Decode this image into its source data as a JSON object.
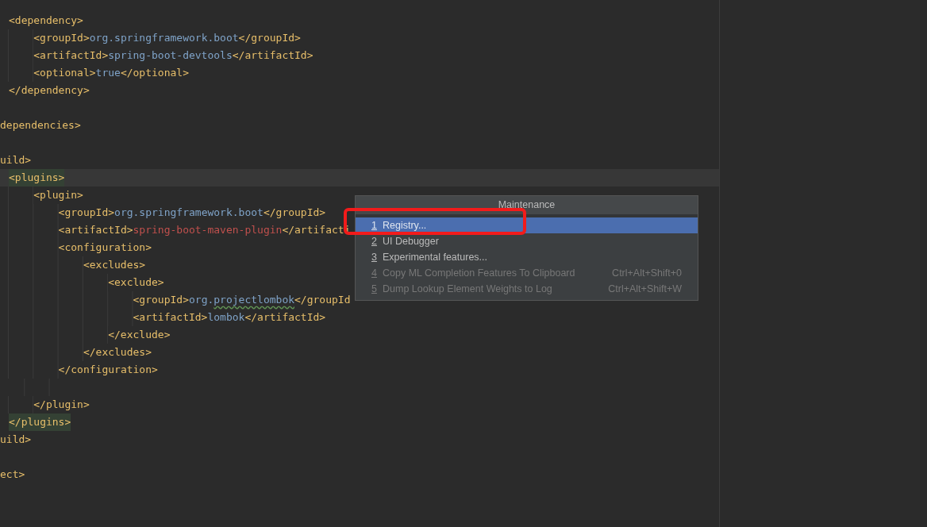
{
  "editor": {
    "lines": [
      {
        "kind": "code",
        "tokens": [
          {
            "kind": "tag",
            "text": "<dependency>"
          }
        ],
        "children": [
          {
            "kind": "code",
            "tokens": [
              {
                "kind": "tag",
                "text": "<groupId>"
              },
              {
                "kind": "text",
                "text": "org.springframework.boot"
              },
              {
                "kind": "tag",
                "text": "</groupId>"
              }
            ]
          },
          {
            "kind": "code",
            "tokens": [
              {
                "kind": "tag",
                "text": "<artifactId>"
              },
              {
                "kind": "text",
                "text": "spring-boot-devtools"
              },
              {
                "kind": "tag",
                "text": "</artifactId>"
              }
            ]
          },
          {
            "kind": "code",
            "tokens": [
              {
                "kind": "tag",
                "text": "<optional>"
              },
              {
                "kind": "text",
                "text": "true"
              },
              {
                "kind": "tag",
                "text": "</optional>"
              }
            ]
          }
        ]
      },
      {
        "kind": "code",
        "tokens": [
          {
            "kind": "tag",
            "text": "</dependency>"
          }
        ]
      },
      {
        "kind": "blank"
      },
      {
        "kind": "clipped",
        "tokens": [
          {
            "kind": "tag",
            "text": "dependencies>"
          }
        ]
      },
      {
        "kind": "blank"
      },
      {
        "kind": "clipped",
        "tokens": [
          {
            "kind": "tag",
            "text": "uild>"
          }
        ]
      },
      {
        "kind": "code",
        "current": true,
        "tokens": [
          {
            "kind": "matched",
            "text": "<plugins>"
          }
        ],
        "children": [
          {
            "kind": "code",
            "tokens": [
              {
                "kind": "tag",
                "text": "<plugin>"
              }
            ],
            "children": [
              {
                "kind": "code",
                "tokens": [
                  {
                    "kind": "tag",
                    "text": "<groupId>"
                  },
                  {
                    "kind": "text",
                    "text": "org.springframework.boot"
                  },
                  {
                    "kind": "tag",
                    "text": "</groupId>"
                  }
                ]
              },
              {
                "kind": "code",
                "tokens": [
                  {
                    "kind": "tag",
                    "text": "<artifactId>"
                  },
                  {
                    "kind": "error",
                    "text": "spring-boot-maven-plugin"
                  },
                  {
                    "kind": "tag",
                    "text": "</artifacti"
                  }
                ]
              },
              {
                "kind": "code",
                "tokens": [
                  {
                    "kind": "tag",
                    "text": "<configuration>"
                  }
                ],
                "children": [
                  {
                    "kind": "code",
                    "tokens": [
                      {
                        "kind": "tag",
                        "text": "<excludes>"
                      }
                    ],
                    "children": [
                      {
                        "kind": "code",
                        "tokens": [
                          {
                            "kind": "tag",
                            "text": "<exclude>"
                          }
                        ],
                        "children": [
                          {
                            "kind": "code",
                            "tokens": [
                              {
                                "kind": "tag",
                                "text": "<groupId>"
                              },
                              {
                                "kind": "text",
                                "text": "org."
                              },
                              {
                                "kind": "typo",
                                "text": "projectlombok"
                              },
                              {
                                "kind": "tag",
                                "text": "</groupId"
                              }
                            ]
                          },
                          {
                            "kind": "code",
                            "tokens": [
                              {
                                "kind": "tag",
                                "text": "<artifactId>"
                              },
                              {
                                "kind": "text",
                                "text": "lombok"
                              },
                              {
                                "kind": "tag",
                                "text": "</artifactId>"
                              }
                            ]
                          }
                        ]
                      },
                      {
                        "kind": "code",
                        "tokens": [
                          {
                            "kind": "tag",
                            "text": "</exclude>"
                          }
                        ]
                      }
                    ]
                  },
                  {
                    "kind": "code",
                    "tokens": [
                      {
                        "kind": "tag",
                        "text": "</excludes>"
                      }
                    ]
                  }
                ]
              },
              {
                "kind": "code",
                "tokens": [
                  {
                    "kind": "tag",
                    "text": "</configuration>"
                  }
                ]
              },
              {
                "kind": "blank"
              }
            ]
          },
          {
            "kind": "code",
            "tokens": [
              {
                "kind": "tag",
                "text": "</plugin>"
              }
            ]
          }
        ]
      },
      {
        "kind": "code",
        "tokens": [
          {
            "kind": "matched",
            "text": "</plugins>"
          }
        ]
      },
      {
        "kind": "clipped",
        "tokens": [
          {
            "kind": "tag",
            "text": "uild>"
          }
        ]
      },
      {
        "kind": "blank"
      },
      {
        "kind": "clipped",
        "tokens": [
          {
            "kind": "tag",
            "text": "ect>"
          }
        ]
      }
    ]
  },
  "popup_menu": {
    "title": "Maintenance",
    "items": [
      {
        "mnemonic": "1",
        "label": "Registry...",
        "selected": true,
        "disabled": false
      },
      {
        "mnemonic": "2",
        "label": "UI Debugger",
        "selected": false,
        "disabled": false
      },
      {
        "mnemonic": "3",
        "label": "Experimental features...",
        "selected": false,
        "disabled": false
      },
      {
        "mnemonic": "4",
        "label": "Copy ML Completion Features To Clipboard",
        "shortcut": "Ctrl+Alt+Shift+0",
        "selected": false,
        "disabled": true
      },
      {
        "mnemonic": "5",
        "label": "Dump Lookup Element Weights to Log",
        "shortcut": "Ctrl+Alt+Shift+W",
        "selected": false,
        "disabled": true
      }
    ]
  }
}
